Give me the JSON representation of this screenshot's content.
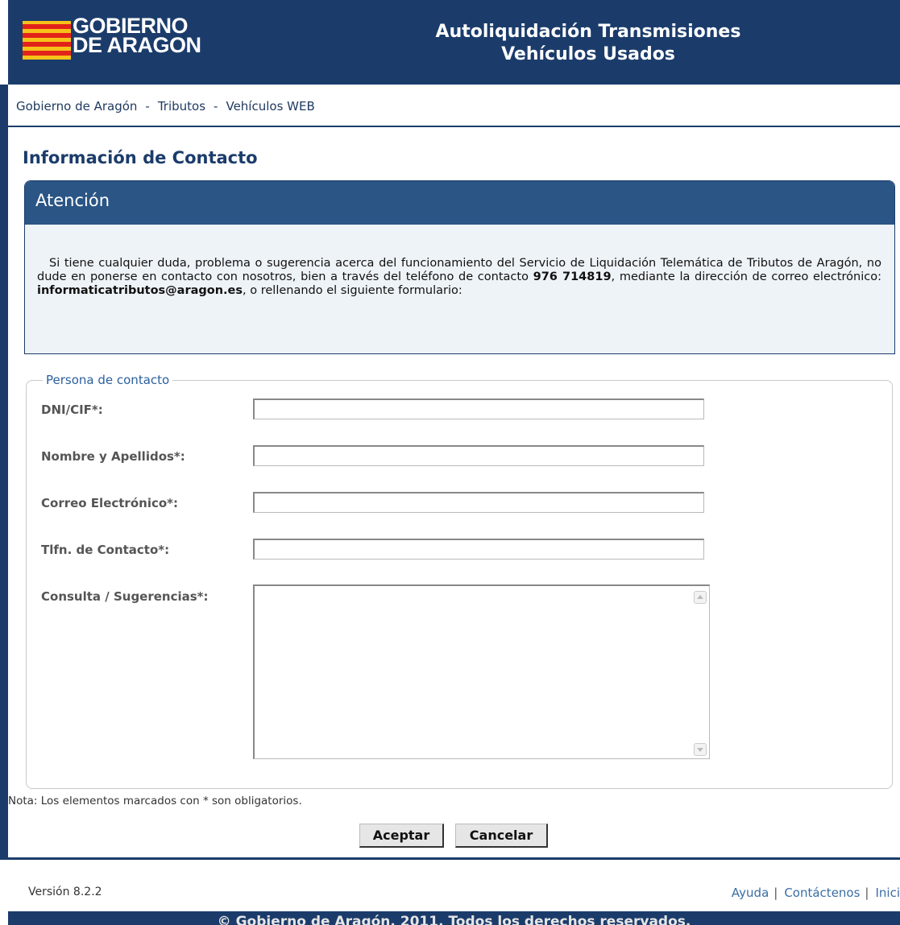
{
  "header": {
    "logo_line1": "GOBIERNO",
    "logo_line2": "DE ARAGON",
    "title_line1": "Autoliquidación Transmisiones",
    "title_line2": "Vehículos Usados"
  },
  "breadcrumb": {
    "items": [
      "Gobierno de Aragón",
      "Tributos",
      "Vehículos WEB"
    ],
    "separator": "-"
  },
  "page_title": "Información de Contacto",
  "attention": {
    "title": "Atención",
    "text_part1": "Si tiene cualquier duda, problema o sugerencia acerca del funcionamiento del Servicio de Liquidación Telemática de Tributos de Aragón, no dude en ponerse en contacto con nosotros, bien a través del teléfono de contacto ",
    "phone": "976 714819",
    "text_part2": ", mediante la dirección de correo electrónico: ",
    "email": "informaticatributos@aragon.es",
    "text_part3": ", o rellenando el siguiente formulario:"
  },
  "form": {
    "legend": "Persona de contacto",
    "fields": [
      {
        "label": "DNI/CIF*:",
        "value": ""
      },
      {
        "label": "Nombre y Apellidos*:",
        "value": ""
      },
      {
        "label": "Correo Electrónico*:",
        "value": ""
      },
      {
        "label": "Tlfn. de Contacto*:",
        "value": ""
      },
      {
        "label": "Consulta / Sugerencias*:",
        "value": ""
      }
    ]
  },
  "note": "Nota: Los elementos marcados con * son obligatorios.",
  "buttons": {
    "accept": "Aceptar",
    "cancel": "Cancelar"
  },
  "footer": {
    "version": "Versión 8.2.2",
    "links": [
      "Ayuda",
      "Contáctenos",
      "Inici"
    ],
    "copyright": "© Gobierno de Aragón. 2011. Todos los derechos reservados."
  },
  "colors": {
    "brand_navy": "#1b3c6b",
    "panel_header": "#2a5585",
    "panel_bg": "#eef3f8",
    "link": "#3a6ea5"
  }
}
